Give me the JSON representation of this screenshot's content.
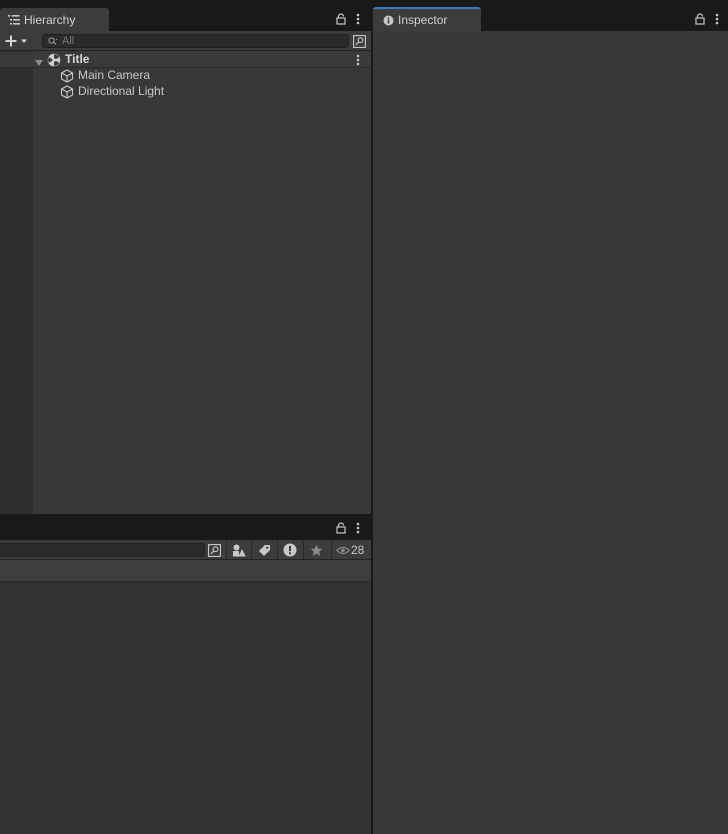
{
  "hierarchy": {
    "tab_label": "Hierarchy",
    "search_placeholder": "All",
    "scene_name": "Title",
    "items": [
      {
        "label": "Main Camera"
      },
      {
        "label": "Directional Light"
      }
    ]
  },
  "inspector": {
    "tab_label": "Inspector"
  },
  "project": {
    "hidden_count": "28"
  },
  "icons": {
    "hierarchy_tab": "list-icon",
    "inspector_tab": "info-icon",
    "lock": "lock-icon",
    "menu": "kebab-menu-icon",
    "add": "plus-dropdown-icon",
    "scene": "unity-scene-icon",
    "gameobject": "cube-icon",
    "search": "search-icon",
    "search_window": "search-window-icon",
    "type_filter": "type-filter-icon",
    "label_filter": "label-tag-icon",
    "import_log": "warning-circle-icon",
    "favorite": "star-icon",
    "visibility": "eye-icon"
  },
  "colors": {
    "accent": "#3a79bb",
    "panel_bg": "#383838",
    "toolbar_bg": "#3c3c3c",
    "titlebar_bg": "#191919"
  }
}
